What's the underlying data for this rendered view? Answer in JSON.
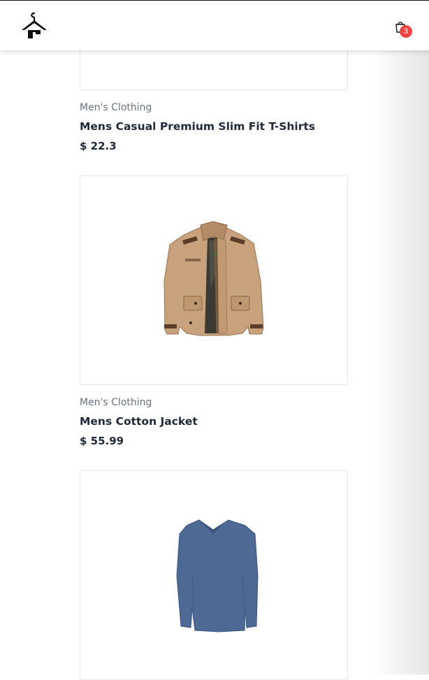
{
  "header": {
    "logo_icon": "hanger-shop-logo-icon",
    "cart_icon": "shopping-bag-icon",
    "cart_count": "3"
  },
  "colors": {
    "badge": "#ef4444",
    "category_text": "#6b7280",
    "title_text": "#1f2937",
    "card_border": "#e5e7eb"
  },
  "products": [
    {
      "category": "Men's Clothing",
      "title": "Mens Casual Premium Slim Fit T-Shirts",
      "price": "$ 22.3",
      "image_icon": "t-shirt-image"
    },
    {
      "category": "Men's Clothing",
      "title": "Mens Cotton Jacket",
      "price": "$ 55.99",
      "image_icon": "jacket-image"
    },
    {
      "category": "",
      "title": "",
      "price": "",
      "image_icon": "long-sleeve-shirt-image"
    }
  ]
}
